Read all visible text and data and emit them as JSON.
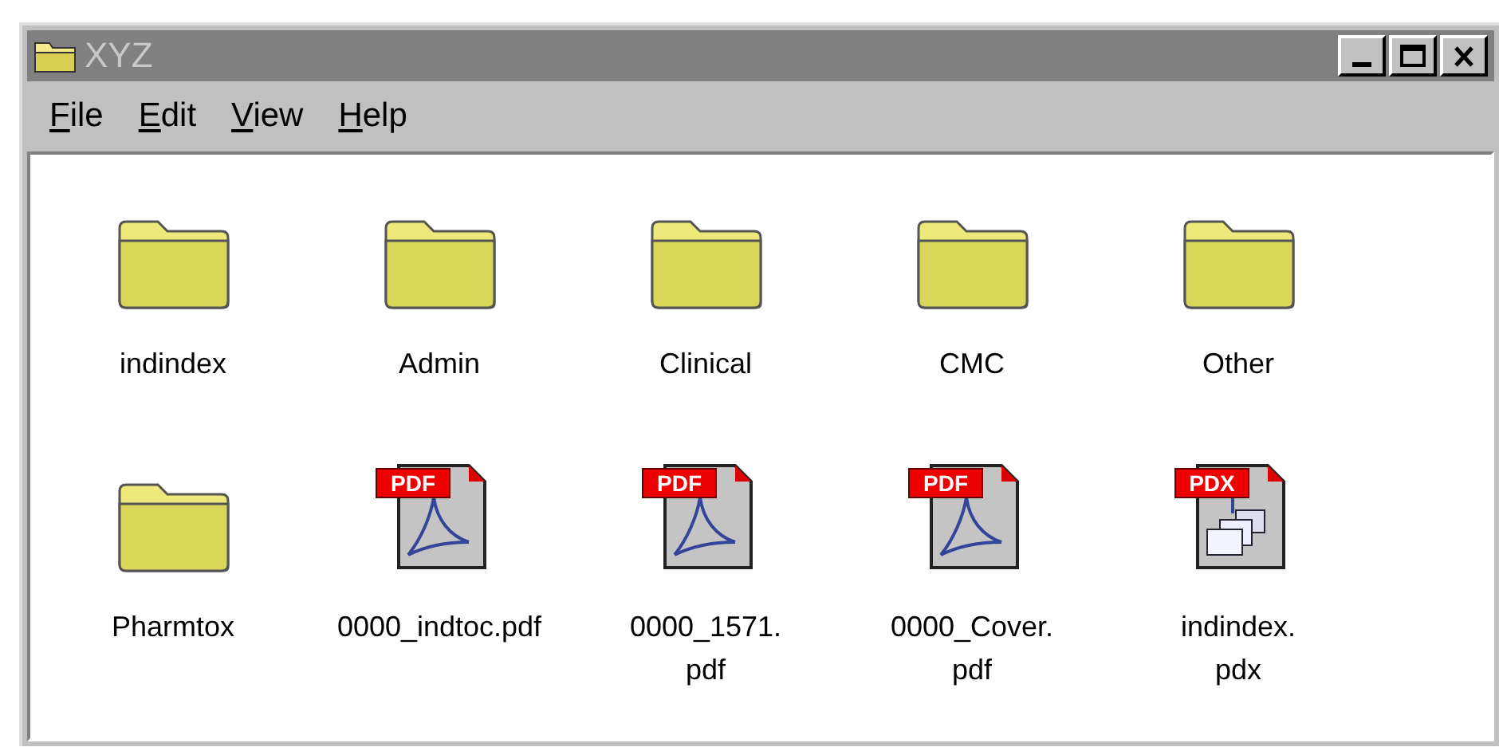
{
  "window": {
    "title": "XYZ"
  },
  "menu": [
    {
      "mnemonic": "F",
      "rest": "ile"
    },
    {
      "mnemonic": "E",
      "rest": "dit"
    },
    {
      "mnemonic": "V",
      "rest": "iew"
    },
    {
      "mnemonic": "H",
      "rest": "elp"
    }
  ],
  "items": [
    {
      "kind": "folder",
      "lines": [
        "indindex"
      ]
    },
    {
      "kind": "folder",
      "lines": [
        "Admin"
      ]
    },
    {
      "kind": "folder",
      "lines": [
        "Clinical"
      ]
    },
    {
      "kind": "folder",
      "lines": [
        "CMC"
      ]
    },
    {
      "kind": "folder",
      "lines": [
        "Other"
      ]
    },
    {
      "kind": "folder",
      "lines": [
        "Pharmtox"
      ]
    },
    {
      "kind": "pdf",
      "badge": "PDF",
      "lines": [
        "0000_indtoc.pdf"
      ]
    },
    {
      "kind": "pdf",
      "badge": "PDF",
      "lines": [
        "0000_1571.",
        "pdf"
      ]
    },
    {
      "kind": "pdf",
      "badge": "PDF",
      "lines": [
        "0000_Cover.",
        "pdf"
      ]
    },
    {
      "kind": "pdx",
      "badge": "PDX",
      "lines": [
        "indindex.",
        "pdx"
      ]
    }
  ]
}
